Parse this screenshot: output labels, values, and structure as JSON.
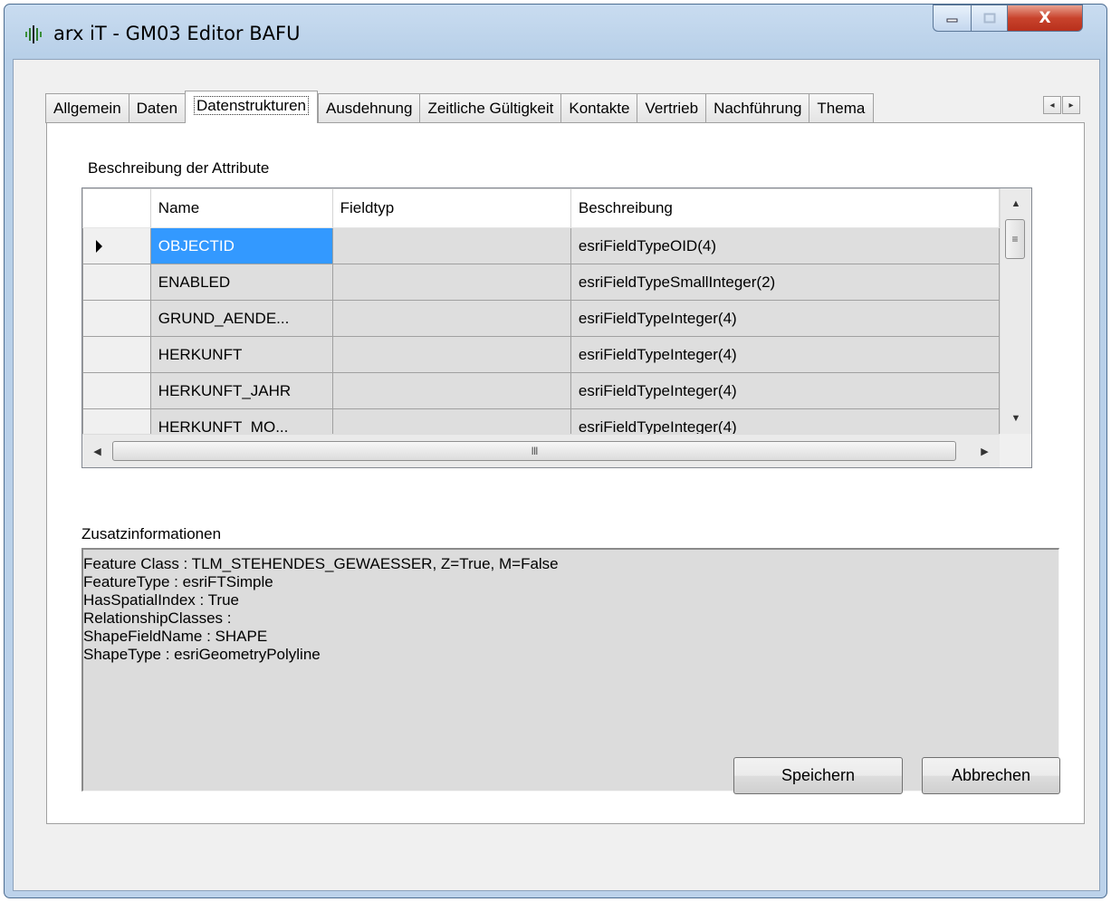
{
  "window": {
    "title": "arx iT - GM03 Editor BAFU",
    "controls": {
      "minimize_icon": "minimize-icon",
      "maximize_icon": "maximize-icon",
      "close_icon": "close-icon",
      "close_label": "X"
    }
  },
  "tabs": [
    {
      "label": "Allgemein",
      "active": false
    },
    {
      "label": "Daten",
      "active": false
    },
    {
      "label": "Datenstrukturen",
      "active": true
    },
    {
      "label": "Ausdehnung",
      "active": false
    },
    {
      "label": "Zeitliche Gültigkeit",
      "active": false
    },
    {
      "label": "Kontakte",
      "active": false
    },
    {
      "label": "Vertrieb",
      "active": false
    },
    {
      "label": "Nachführung",
      "active": false
    },
    {
      "label": "Thema",
      "active": false
    }
  ],
  "attributes": {
    "section_label": "Beschreibung der Attribute",
    "columns": [
      "Name",
      "Fieldtyp",
      "Beschreibung"
    ],
    "rows": [
      {
        "name": "OBJECTID",
        "fieldtyp": "",
        "beschreibung": "esriFieldTypeOID(4)",
        "selected": true
      },
      {
        "name": "ENABLED",
        "fieldtyp": "",
        "beschreibung": "esriFieldTypeSmallInteger(2)",
        "selected": false
      },
      {
        "name": "GRUND_AENDE...",
        "fieldtyp": "",
        "beschreibung": "esriFieldTypeInteger(4)",
        "selected": false
      },
      {
        "name": "HERKUNFT",
        "fieldtyp": "",
        "beschreibung": "esriFieldTypeInteger(4)",
        "selected": false
      },
      {
        "name": "HERKUNFT_JAHR",
        "fieldtyp": "",
        "beschreibung": "esriFieldTypeInteger(4)",
        "selected": false
      },
      {
        "name": "HERKUNFT_MO...",
        "fieldtyp": "",
        "beschreibung": "esriFieldTypeInteger(4)",
        "selected": false
      }
    ],
    "hscroll_grip": "III"
  },
  "zusatz": {
    "label": "Zusatzinformationen",
    "lines": [
      "Feature Class : TLM_STEHENDES_GEWAESSER, Z=True, M=False",
      "FeatureType : esriFTSimple",
      "HasSpatialIndex : True",
      "RelationshipClasses :",
      "ShapeFieldName : SHAPE",
      "ShapeType : esriGeometryPolyline"
    ]
  },
  "buttons": {
    "save": "Speichern",
    "cancel": "Abbrechen"
  }
}
